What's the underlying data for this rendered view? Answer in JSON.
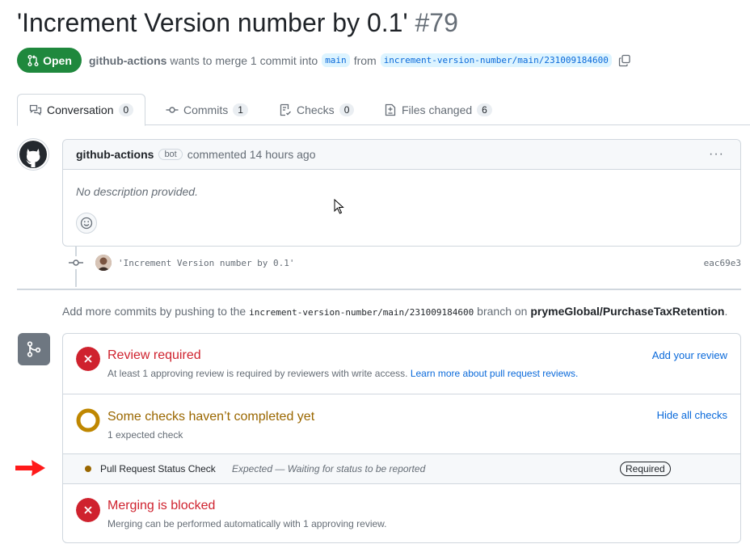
{
  "pr": {
    "title": "'Increment Version number by 0.1'",
    "number": "#79",
    "state": "Open",
    "author": "github-actions",
    "action_text": "wants to merge 1 commit into",
    "base_branch": "main",
    "from_text": "from",
    "head_branch": "increment-version-number/main/231009184600"
  },
  "tabs": [
    {
      "label": "Conversation",
      "count": "0"
    },
    {
      "label": "Commits",
      "count": "1"
    },
    {
      "label": "Checks",
      "count": "0"
    },
    {
      "label": "Files changed",
      "count": "6"
    }
  ],
  "comment": {
    "author": "github-actions",
    "badge": "bot",
    "timestamp": "commented 14 hours ago",
    "kebab": "···",
    "body": "No description provided."
  },
  "commit": {
    "message": "'Increment Version number by 0.1'",
    "sha": "eac69e3"
  },
  "push_info": {
    "prefix": "Add more commits by pushing to the",
    "branch": "increment-version-number/main/231009184600",
    "middle": "branch on",
    "repo": "prymeGlobal/PurchaseTaxRetention",
    "suffix": "."
  },
  "merge_box": {
    "review": {
      "title": "Review required",
      "subtitle": "At least 1 approving review is required by reviewers with write access.",
      "link": "Learn more about pull request reviews.",
      "action": "Add your review"
    },
    "checks": {
      "title": "Some checks haven’t completed yet",
      "subtitle": "1 expected check",
      "action": "Hide all checks"
    },
    "check_item": {
      "name": "Pull Request Status Check",
      "description": "Expected — Waiting for status to be reported",
      "badge": "Required"
    },
    "blocked": {
      "title": "Merging is blocked",
      "subtitle": "Merging can be performed automatically with 1 approving review."
    }
  },
  "colors": {
    "open_green": "#1f883d",
    "error_red": "#cf222e",
    "pending_yellow": "#9a6700",
    "link_blue": "#0969da",
    "annotation_arrow": "#ff0000"
  },
  "icons": {
    "state": "git-pull-request-icon",
    "copy": "copy-icon",
    "conversation": "comment-discussion-icon",
    "commits": "git-commit-icon",
    "checks": "checklist-icon",
    "files": "file-diff-icon",
    "avatar": "github-octocat-icon",
    "emoji": "smiley-icon",
    "merge": "git-merge-icon",
    "fail": "x-circle-icon",
    "pending": "pending-ring-icon"
  }
}
